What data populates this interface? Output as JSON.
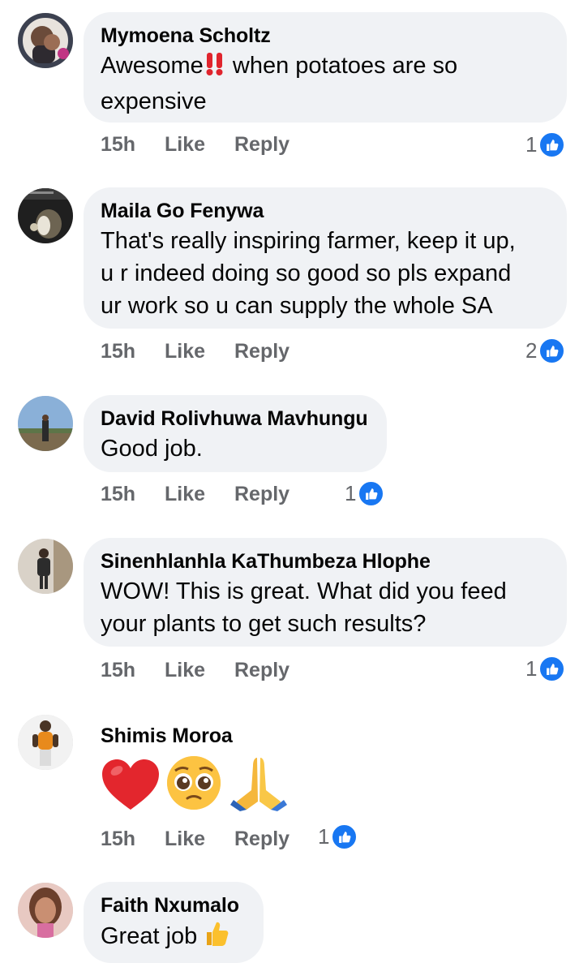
{
  "like_icon_color": "#1877f2",
  "comments": [
    {
      "author": "Mymoena Scholtz",
      "text_lines": [
        "Awesome",
        " when potatoes are so",
        "expensive"
      ],
      "emoji": "double-exclamation-icon",
      "time": "15h",
      "like_label": "Like",
      "reply_label": "Reply",
      "reactions": "1"
    },
    {
      "author": "Maila Go Fenywa",
      "text_lines": [
        "That's really inspiring farmer, keep it up,",
        "u r indeed doing so good so pls expand",
        "ur work so u can supply the whole SA"
      ],
      "time": "15h",
      "like_label": "Like",
      "reply_label": "Reply",
      "reactions": "2"
    },
    {
      "author": "David Rolivhuwa Mavhungu",
      "text_lines": [
        "Good job."
      ],
      "time": "15h",
      "like_label": "Like",
      "reply_label": "Reply",
      "reactions": "1"
    },
    {
      "author": "Sinenhlanhla KaThumbeza Hlophe",
      "text_lines": [
        "WOW! This is great. What did you feed",
        "your plants to get such results?"
      ],
      "time": "15h",
      "like_label": "Like",
      "reply_label": "Reply",
      "reactions": "1"
    },
    {
      "author": "Shimis Moroa",
      "emojis": [
        "red-heart-icon",
        "pleading-face-icon",
        "folded-hands-icon"
      ],
      "time": "15h",
      "like_label": "Like",
      "reply_label": "Reply",
      "reactions": "1"
    },
    {
      "author": "Faith Nxumalo",
      "text_lines": [
        "Great job "
      ],
      "emoji": "thumbs-up-icon"
    }
  ]
}
